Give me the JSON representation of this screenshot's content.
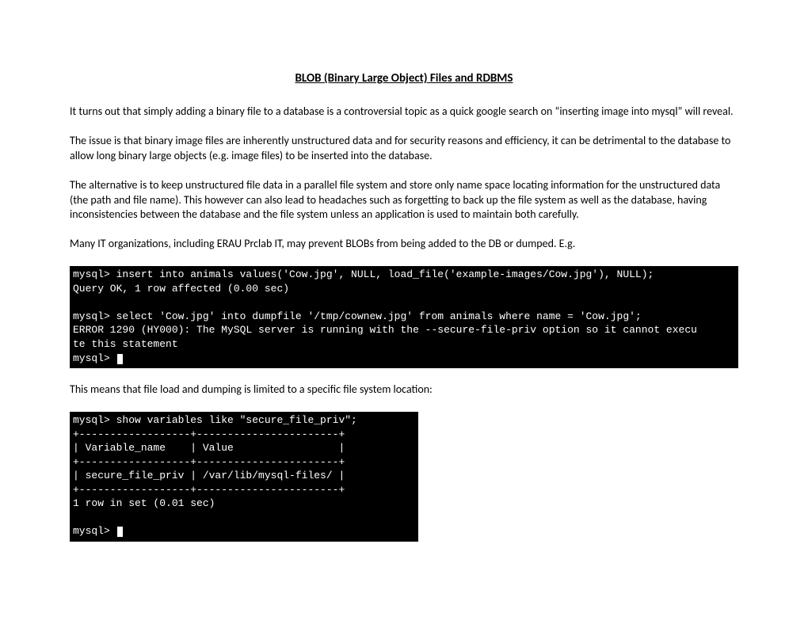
{
  "title": "BLOB (Binary Large Object) Files and RDBMS",
  "para1": "It turns out that simply adding a binary file to a database is a controversial topic as a quick google search on “inserting image into mysql” will reveal.",
  "para2": "The issue is that binary image files are inherently unstructured data and for security reasons and efficiency, it can be detrimental to the database to allow long binary large objects (e.g. image files) to be inserted into the database.",
  "para3": "The alternative is to keep unstructured file data in a parallel file system and store only name space locating information for the unstructured data (the path and file name).  This however can also lead to headaches such as forgetting to back up the file system as well as the database, having inconsistencies between the database and the file system unless an application is used to maintain both carefully.",
  "para4": "Many IT organizations, including ERAU Prclab IT, may prevent BLOBs from being added to the DB or dumped.  E.g.",
  "para5": "This means that file load and dumping is limited to a specific file system location:",
  "terminal1": {
    "l1": "mysql> insert into animals values('Cow.jpg', NULL, load_file('example-images/Cow.jpg'), NULL);",
    "l2": "Query OK, 1 row affected (0.00 sec)",
    "l3": " ",
    "l4": "mysql> select 'Cow.jpg' into dumpfile '/tmp/cownew.jpg' from animals where name = 'Cow.jpg';",
    "l5": "ERROR 1290 (HY000): The MySQL server is running with the --secure-file-priv option so it cannot execu",
    "l6": "te this statement",
    "l7": "mysql> "
  },
  "terminal2": {
    "l1": "mysql> show variables like \"secure_file_priv\";",
    "l2": "+------------------+-----------------------+",
    "l3": "| Variable_name    | Value                 |",
    "l4": "+------------------+-----------------------+",
    "l5": "| secure_file_priv | /var/lib/mysql-files/ |",
    "l6": "+------------------+-----------------------+",
    "l7": "1 row in set (0.01 sec)",
    "l8": " ",
    "l9": "mysql> "
  }
}
